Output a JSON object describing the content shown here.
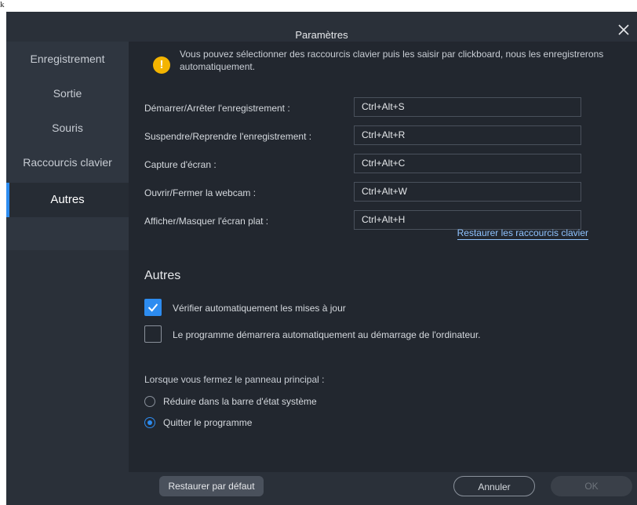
{
  "window": {
    "title": "Paramètres"
  },
  "sidebar": {
    "items": [
      {
        "label": "Enregistrement"
      },
      {
        "label": "Sortie"
      },
      {
        "label": "Souris"
      },
      {
        "label": "Raccourcis clavier"
      },
      {
        "label": "Autres",
        "active": true
      }
    ]
  },
  "shortcuts": {
    "notice": "Vous pouvez sélectionner des raccourcis clavier puis les saisir par clickboard, nous les enregistrerons automatiquement.",
    "rows": [
      {
        "label": "Démarrer/Arrêter l'enregistrement :",
        "value": "Ctrl+Alt+S"
      },
      {
        "label": "Suspendre/Reprendre l'enregistrement :",
        "value": "Ctrl+Alt+R"
      },
      {
        "label": "Capture d'écran :",
        "value": "Ctrl+Alt+C"
      },
      {
        "label": "Ouvrir/Fermer la webcam :",
        "value": "Ctrl+Alt+W"
      },
      {
        "label": "Afficher/Masquer l'écran plat :",
        "value": "Ctrl+Alt+H"
      }
    ],
    "restore_link": "Restaurer les raccourcis clavier"
  },
  "others": {
    "title": "Autres",
    "check_updates": {
      "label": "Vérifier automatiquement les mises à jour",
      "checked": true
    },
    "autostart": {
      "label": "Le programme démarrera automatiquement au démarrage de l'ordinateur.",
      "checked": false
    },
    "close_question": "Lorsque vous fermez le panneau principal :",
    "close_options": [
      {
        "label": "Réduire dans la barre d'état système",
        "selected": false
      },
      {
        "label": "Quitter le programme",
        "selected": true
      }
    ]
  },
  "footer": {
    "restore_default": "Restaurer par défaut",
    "cancel": "Annuler",
    "ok": "OK"
  },
  "colors": {
    "accent": "#2d8cf0",
    "warning": "#f4b400",
    "link": "#8fc3ff"
  },
  "icons": {
    "close": "close-icon",
    "warning": "warning-icon",
    "check": "check-icon"
  }
}
